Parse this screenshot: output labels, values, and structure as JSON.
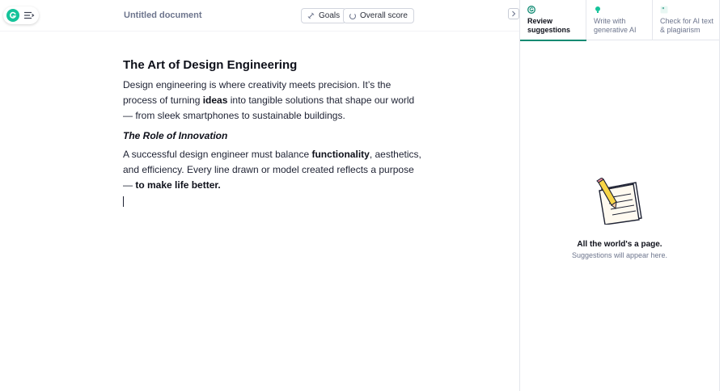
{
  "header": {
    "doc_title": "Untitled document",
    "goals_label": "Goals",
    "score_label": "Overall score"
  },
  "document": {
    "heading": "The Art of Design Engineering",
    "p1_part1": "Design engineering is where creativity meets precision. It’s the process of turning ",
    "p1_bold": "ideas",
    "p1_part2": " into tangible solutions that shape our world — from sleek smartphones to sustainable buildings.",
    "subheading": "The Role of Innovation",
    "p2_part1": "A successful design engineer must balance ",
    "p2_bold1": "functionality",
    "p2_part2": ", aesthetics, and efficiency. Every line drawn or model created reflects a purpose — ",
    "p2_bold2": "to make life better."
  },
  "panel": {
    "tabs": [
      {
        "label": "Review suggestions",
        "icon": "grammarly-icon",
        "active": true
      },
      {
        "label": "Write with generative AI",
        "icon": "lightbulb-icon",
        "active": false
      },
      {
        "label": "Check for AI text & plagiarism",
        "icon": "quote-icon",
        "active": false
      }
    ],
    "empty_title": "All the world's a page.",
    "empty_subtitle": "Suggestions will appear here."
  },
  "colors": {
    "brand": "#15c39a",
    "active_tab_underline": "#0e8a72"
  }
}
